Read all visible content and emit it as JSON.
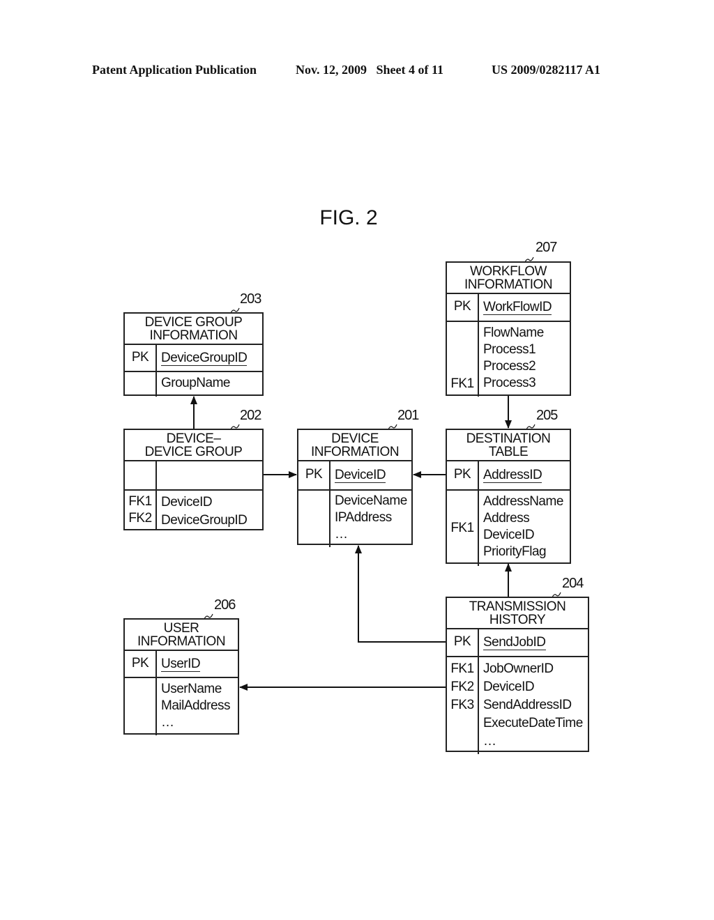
{
  "header": {
    "publication": "Patent Application Publication",
    "date_sheet": "Nov. 12, 2009   Sheet 4 of 11",
    "number": "US 2009/0282117 A1"
  },
  "figure": {
    "label": "FIG. 2"
  },
  "entities": {
    "device_group_info": {
      "ref": "203",
      "title1": "DEVICE GROUP",
      "title2": "INFORMATION",
      "pk_key": "PK",
      "pk": "DeviceGroupID",
      "fields": [
        "GroupName"
      ],
      "fk_keys": [
        ""
      ]
    },
    "device_device_group": {
      "ref": "202",
      "title1": "DEVICE–",
      "title2": "DEVICE GROUP",
      "pk_key": "",
      "pk": "",
      "fields": [
        "DeviceID",
        "DeviceGroupID"
      ],
      "fk_keys": [
        "FK1",
        "FK2"
      ]
    },
    "device_info": {
      "ref": "201",
      "title1": "DEVICE",
      "title2": "INFORMATION",
      "pk_key": "PK",
      "pk": "DeviceID",
      "fields": [
        "DeviceName",
        "IPAddress",
        "…"
      ],
      "fk_keys": [
        ""
      ]
    },
    "workflow_info": {
      "ref": "207",
      "title1": "WORKFLOW",
      "title2": "INFORMATION",
      "pk_key": "PK",
      "pk": "WorkFlowID",
      "fields": [
        "FlowName",
        "Process1",
        "Process2",
        "Process3"
      ],
      "fk_keys": [
        "FK1"
      ]
    },
    "destination_table": {
      "ref": "205",
      "title1": "DESTINATION",
      "title2": "TABLE",
      "pk_key": "PK",
      "pk": "AddressID",
      "fields": [
        "AddressName",
        "Address",
        "DeviceID",
        "PriorityFlag"
      ],
      "fk_keys": [
        "FK1"
      ]
    },
    "transmission_history": {
      "ref": "204",
      "title1": "TRANSMISSION",
      "title2": "HISTORY",
      "pk_key": "PK",
      "pk": "SendJobID",
      "fields": [
        "JobOwnerID",
        "DeviceID",
        "SendAddressID",
        "ExecuteDateTime",
        "…"
      ],
      "fk_keys": [
        "FK1",
        "FK2",
        "FK3"
      ]
    },
    "user_info": {
      "ref": "206",
      "title1": "USER",
      "title2": "INFORMATION",
      "pk_key": "PK",
      "pk": "UserID",
      "fields": [
        "UserName",
        "MailAddress",
        "…"
      ],
      "fk_keys": [
        ""
      ]
    }
  }
}
